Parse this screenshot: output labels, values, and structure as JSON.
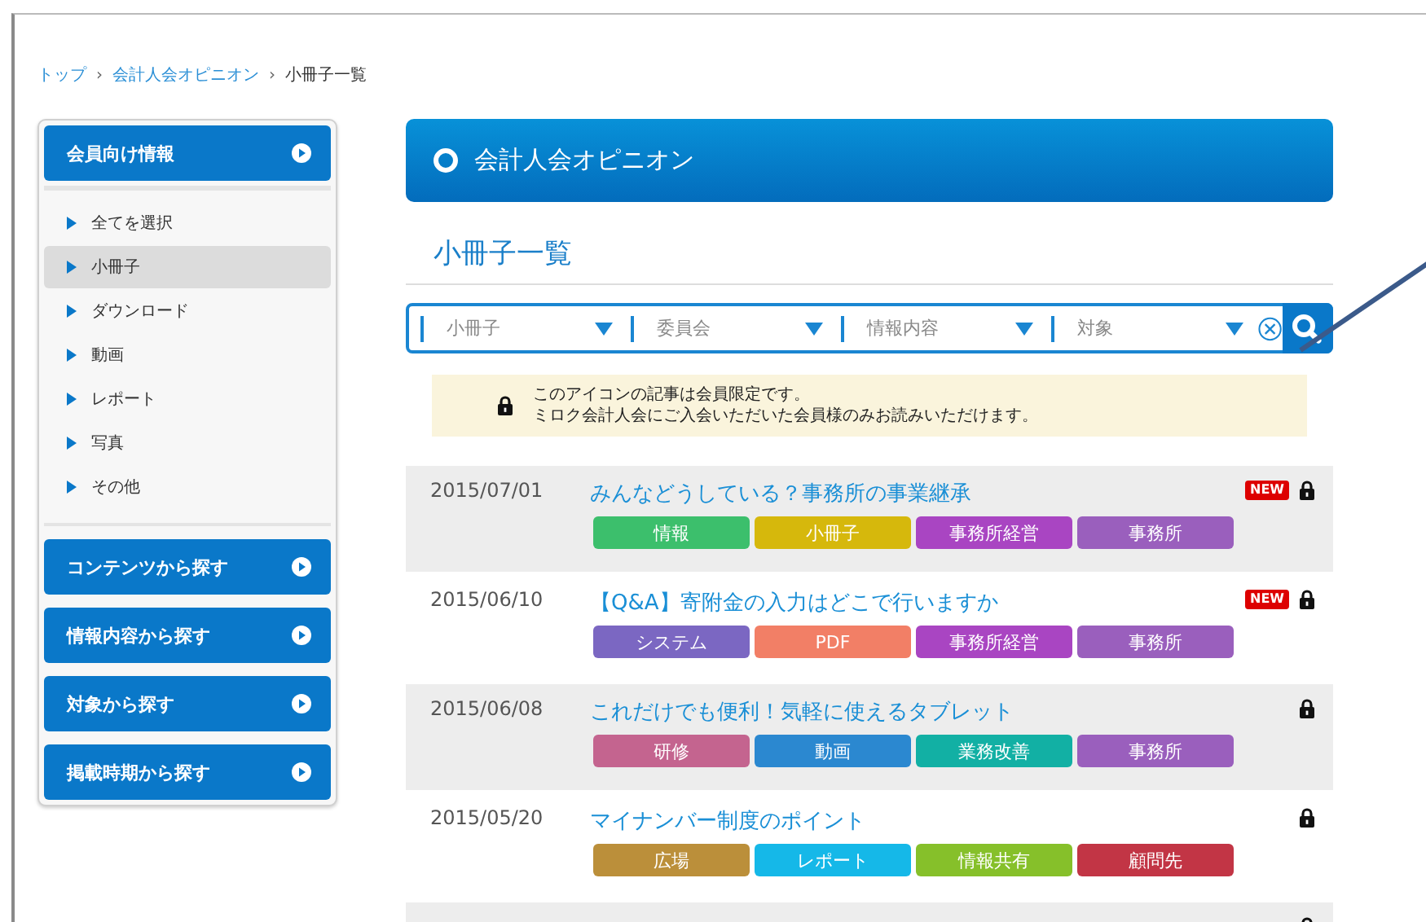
{
  "breadcrumb": [
    {
      "label": "トップ",
      "link": true,
      "separator": "›"
    },
    {
      "label": "会計人会オピニオン",
      "link": true,
      "separator": "›"
    },
    {
      "label": "小冊子一覧",
      "link": false
    }
  ],
  "sidebar": {
    "sections": [
      {
        "label": "会員向け情報",
        "items": [
          {
            "label": "全てを選択",
            "selected": false
          },
          {
            "label": "小冊子",
            "selected": true
          },
          {
            "label": "ダウンロード",
            "selected": false
          },
          {
            "label": "動画",
            "selected": false
          },
          {
            "label": "レポート",
            "selected": false
          },
          {
            "label": "写真",
            "selected": false
          },
          {
            "label": "その他",
            "selected": false
          }
        ]
      },
      {
        "label": "コンテンツから探す"
      },
      {
        "label": "情報内容から探す"
      },
      {
        "label": "対象から探す"
      },
      {
        "label": "掲載時期から探す"
      }
    ]
  },
  "banner": {
    "title": "会計人会オピニオン"
  },
  "page_title": "小冊子一覧",
  "search": {
    "dropdowns": [
      {
        "value": "小冊子"
      },
      {
        "value": "委員会"
      },
      {
        "value": "情報内容"
      },
      {
        "value": "対象"
      }
    ]
  },
  "notice": {
    "lines": [
      "このアイコンの記事は会員限定です。",
      "ミロク会計人会にご入会いただいた会員様のみお読みいただけます。"
    ]
  },
  "articles": [
    {
      "date": "2015/07/01",
      "title": "みんなどうしている？事務所の事業継承",
      "new": true,
      "new_label": "NEW",
      "locked": true,
      "tags": [
        {
          "label": "情報",
          "color": "#3cbf6c"
        },
        {
          "label": "小冊子",
          "color": "#d6b80c"
        },
        {
          "label": "事務所経営",
          "color": "#a945c2"
        },
        {
          "label": "事務所",
          "color": "#9a5fbd"
        }
      ]
    },
    {
      "date": "2015/06/10",
      "title": "【Q&A】寄附金の入力はどこで行いますか",
      "new": true,
      "new_label": "NEW",
      "locked": true,
      "tags": [
        {
          "label": "システム",
          "color": "#7b67c2"
        },
        {
          "label": "PDF",
          "color": "#f27f66"
        },
        {
          "label": "事務所経営",
          "color": "#a945c2"
        },
        {
          "label": "事務所",
          "color": "#9a5fbd"
        }
      ]
    },
    {
      "date": "2015/06/08",
      "title": "これだけでも便利！気軽に使えるタブレット",
      "new": false,
      "locked": true,
      "tags": [
        {
          "label": "研修",
          "color": "#c4648f"
        },
        {
          "label": "動画",
          "color": "#2b88d0"
        },
        {
          "label": "業務改善",
          "color": "#12b0a4"
        },
        {
          "label": "事務所",
          "color": "#9a5fbd"
        }
      ]
    },
    {
      "date": "2015/05/20",
      "title": "マイナンバー制度のポイント",
      "new": false,
      "locked": true,
      "tags": [
        {
          "label": "広場",
          "color": "#bb8f3a"
        },
        {
          "label": "レポート",
          "color": "#15b8e8"
        },
        {
          "label": "情報共有",
          "color": "#86c02a"
        },
        {
          "label": "顧問先",
          "color": "#c23545"
        }
      ]
    },
    {
      "new": false,
      "locked": true
    }
  ]
}
